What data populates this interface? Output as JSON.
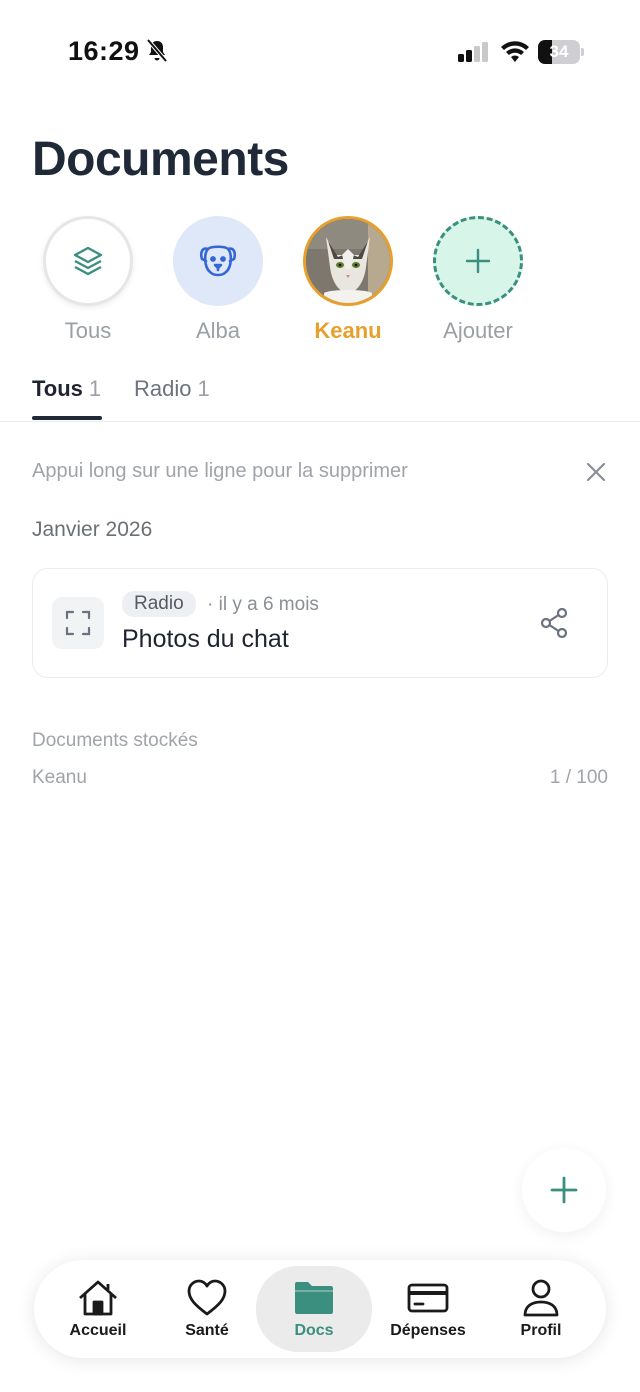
{
  "status_bar": {
    "time": "16:29",
    "battery": "34",
    "battery_level": 0.34
  },
  "page_title": "Documents",
  "pets": [
    {
      "name": "Tous",
      "icon": "layers-icon"
    },
    {
      "name": "Alba",
      "icon": "dog-face-icon"
    },
    {
      "name": "Keanu",
      "icon": "cat-photo-avatar",
      "active": true
    },
    {
      "name": "Ajouter",
      "icon": "plus-icon"
    }
  ],
  "tabs": [
    {
      "label": "Tous",
      "count": "1",
      "active": true
    },
    {
      "label": "Radio",
      "count": "1"
    }
  ],
  "hint": "Appui long sur une ligne pour la supprimer",
  "month": "Janvier 2026",
  "documents": [
    {
      "tag": "Radio",
      "time": "· il y a 6 mois",
      "title": "Photos du chat"
    }
  ],
  "storage": {
    "label": "Documents stockés",
    "pet": "Keanu",
    "count": "1 / 100"
  },
  "nav": [
    {
      "label": "Accueil",
      "icon": "home-icon"
    },
    {
      "label": "Santé",
      "icon": "heart-icon"
    },
    {
      "label": "Docs",
      "icon": "folder-icon",
      "active": true
    },
    {
      "label": "Dépenses",
      "icon": "card-icon"
    },
    {
      "label": "Profil",
      "icon": "user-icon"
    }
  ],
  "colors": {
    "accent": "#3b8f7e",
    "active_pet": "#e8a02c",
    "title": "#1f2937"
  }
}
